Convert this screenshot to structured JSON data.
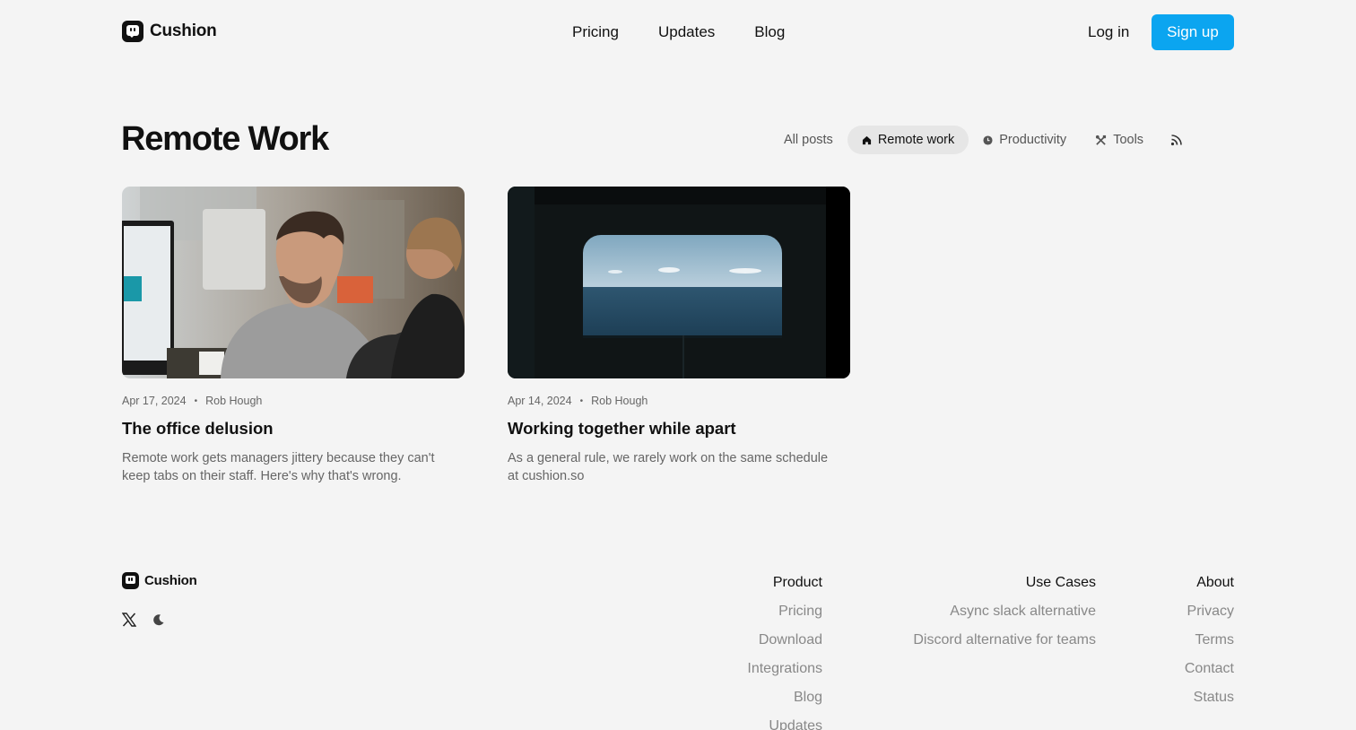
{
  "brand": {
    "name": "Cushion"
  },
  "nav": {
    "items": [
      "Pricing",
      "Updates",
      "Blog"
    ]
  },
  "auth": {
    "login": "Log in",
    "signup": "Sign up"
  },
  "page": {
    "title": "Remote Work"
  },
  "filters": {
    "all": "All posts",
    "remote": "Remote work",
    "productivity": "Productivity",
    "tools": "Tools"
  },
  "posts": [
    {
      "date": "Apr 17, 2024",
      "author": "Rob Hough",
      "title": "The office delusion",
      "excerpt": "Remote work gets managers jittery because they can't keep tabs on their staff. Here's why that's wrong."
    },
    {
      "date": "Apr 14, 2024",
      "author": "Rob Hough",
      "title": "Working together while apart",
      "excerpt": "As a general rule, we rarely work on the same schedule at cushion.so"
    }
  ],
  "footer": {
    "product": {
      "heading": "Product",
      "links": [
        "Pricing",
        "Download",
        "Integrations",
        "Blog",
        "Updates"
      ]
    },
    "use_cases": {
      "heading": "Use Cases",
      "links": [
        "Async slack alternative",
        "Discord alternative for teams"
      ]
    },
    "about": {
      "heading": "About",
      "links": [
        "Privacy",
        "Terms",
        "Contact",
        "Status"
      ]
    }
  },
  "colors": {
    "accent": "#0ba5f0",
    "background": "#f4f4f4",
    "text": "#111111",
    "muted": "#888888"
  },
  "icons": [
    "logo-icon",
    "home-icon",
    "clock-icon",
    "tools-icon",
    "rss-icon",
    "x-icon",
    "moon-icon"
  ]
}
